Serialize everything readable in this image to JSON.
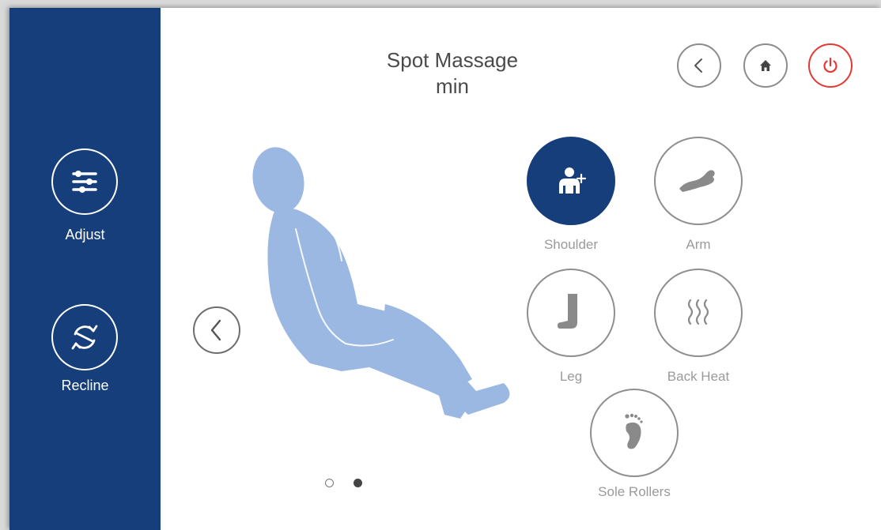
{
  "header": {
    "title_line1": "Spot Massage",
    "title_line2": "min"
  },
  "top_buttons": [
    {
      "name": "back",
      "icon": "chevron-left-icon"
    },
    {
      "name": "home",
      "icon": "home-icon"
    },
    {
      "name": "power",
      "icon": "power-icon"
    }
  ],
  "sidebar": {
    "items": [
      {
        "label": "Adjust",
        "icon": "sliders-icon"
      },
      {
        "label": "Recline",
        "icon": "recline-icon"
      }
    ]
  },
  "zones": [
    {
      "label": "Shoulder",
      "icon": "shoulder-icon",
      "active": true
    },
    {
      "label": "Arm",
      "icon": "arm-icon",
      "active": false
    },
    {
      "label": "Leg",
      "icon": "leg-icon",
      "active": false
    },
    {
      "label": "Back Heat",
      "icon": "heat-icon",
      "active": false
    },
    {
      "label": "Sole Rollers",
      "icon": "foot-icon",
      "active": false
    }
  ],
  "pagination": {
    "pages": 2,
    "current": 2
  },
  "colors": {
    "sidebar": "#153e7b",
    "active_zone": "#153e7b",
    "body_figure": "#9bb8e3",
    "power": "#e53935",
    "icon_gray": "#8a8a8a"
  }
}
